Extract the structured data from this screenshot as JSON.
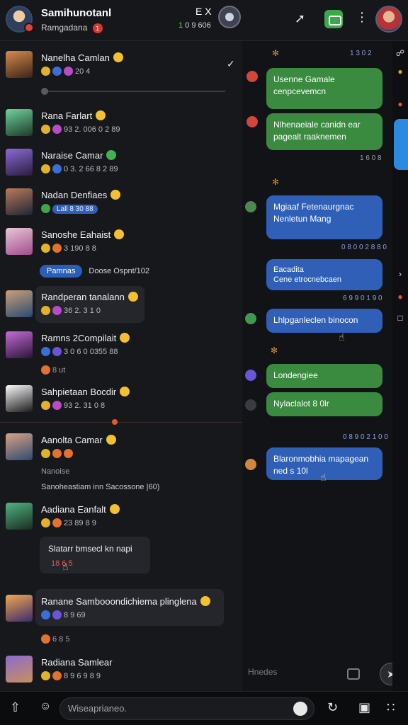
{
  "header": {
    "title": "Samihunotanl",
    "subtitle": "Ramgadana",
    "subtitle_badge": "1",
    "counter_prefix": "1",
    "counter_text": "0 9 606",
    "close_label": "E X"
  },
  "chats": [
    {
      "name": "Nanelha Camlan",
      "meta": "20 4"
    },
    {
      "name": "Rana Farlart",
      "meta": "93 2.   006   0 2  89"
    },
    {
      "name": "Naraise Camar",
      "meta": "0 3.   2 66   8 2  89"
    },
    {
      "name": "Nadan Denfiaes",
      "meta": "Lall   8 30   88"
    },
    {
      "name": "Sanoshe Eahaist",
      "meta": "3 190   8 8"
    },
    {
      "name": "Randperan tanalann",
      "meta": "36 2.   3 1 0"
    },
    {
      "name": "Ramns 2Compilait",
      "meta": "3 0 6   0 0355   88"
    },
    {
      "name": "Sahpietaan Bocdir",
      "meta": "93 2.   31 0   8"
    },
    {
      "name": "Aanolta Camar",
      "meta": ""
    },
    {
      "name": "Aadiana Eanfalt",
      "meta": "23 89   8 9"
    },
    {
      "name": "Ranane Sambooondichiema plinglena",
      "meta": "8 9 69"
    },
    {
      "name": "Radiana Samlear",
      "meta": "8 9 6 9   8 9"
    }
  ],
  "chip": {
    "pill": "Pamnas",
    "text": "Doose Ospnt/102"
  },
  "extra_lines": {
    "after_row7": "8 ut",
    "after_row9a": "Nanoise",
    "after_row9b": "Sanoheastiam inn Sacossone |60)",
    "after_row11": "6 8 5",
    "red_card_title": "Slatarr bmsecl kn napi",
    "red_card_meta": "18 6 5"
  },
  "messages": [
    {
      "type": "sent",
      "text": "Usenne Gamale\ncenpcevemcn",
      "ts": "1 3 0 2"
    },
    {
      "type": "sent",
      "text": "Nlhenaeiale canidn ear\npagealt    raaknemen",
      "ts": "1 6 0 8"
    },
    {
      "type": "recv",
      "text": "Mgiaaf Fetenaurgnac\nNenletun    Mang",
      "ts": "0 8 0 0 2 8 8 0"
    },
    {
      "type": "recv",
      "text": "Eacadita\nCene etrocnebcaen",
      "ts": "6 9 9 0 1 9 0"
    },
    {
      "type": "recv",
      "text": "Lhlpganleclen binocon",
      "ts": ""
    },
    {
      "type": "sent",
      "text": "Londengiee",
      "ts": ""
    },
    {
      "type": "sent",
      "text": "Nylaclalot      8 0lr",
      "ts": "0 8 9 0 2 1 0 0"
    },
    {
      "type": "recv",
      "text": "Blaronmobhia mapagean\nned s 10l",
      "ts": ""
    }
  ],
  "pane_input_placeholder": "Hnedes",
  "bottom_bar": {
    "placeholder": "Wiseaprianeo."
  },
  "colors": {
    "green_bubble": "#3a8a3f",
    "blue_bubble": "#2f5fb6",
    "background": "#121316",
    "accent_red": "#d6372f"
  },
  "icons": [
    "share-icon",
    "game-icon",
    "more-icon",
    "check-icon",
    "send-icon",
    "attach-icon",
    "emoji-icon",
    "mic-icon",
    "grid-icon"
  ]
}
